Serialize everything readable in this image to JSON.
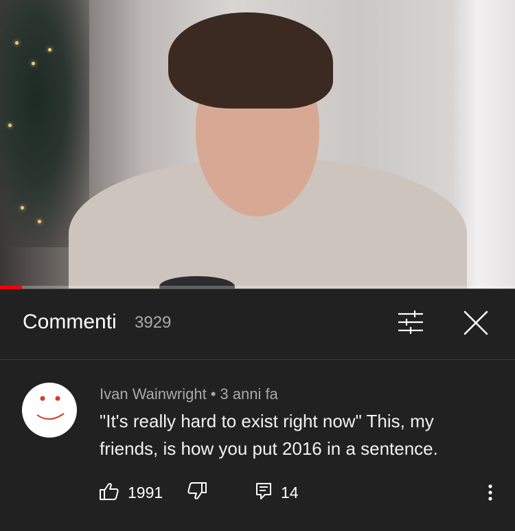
{
  "video": {
    "progress_percent": 4.3
  },
  "comments_panel": {
    "title": "Commenti",
    "count": "3929",
    "icons": {
      "filter": "sort-filter-icon",
      "close": "close-icon"
    }
  },
  "comment": {
    "author": "Ivan Wainwright",
    "separator": "•",
    "time": "3 anni fa",
    "text": "\"It's really hard to exist right now\" This, my friends, is how you put 2016 in a sentence.",
    "likes": "1991",
    "replies": "14",
    "icons": {
      "like": "thumbs-up-icon",
      "dislike": "thumbs-down-icon",
      "reply": "reply-comment-icon",
      "more": "more-vertical-icon"
    }
  },
  "colors": {
    "background": "#212121",
    "secondary_text": "#aaaaaa",
    "progress": "#ff0000"
  }
}
